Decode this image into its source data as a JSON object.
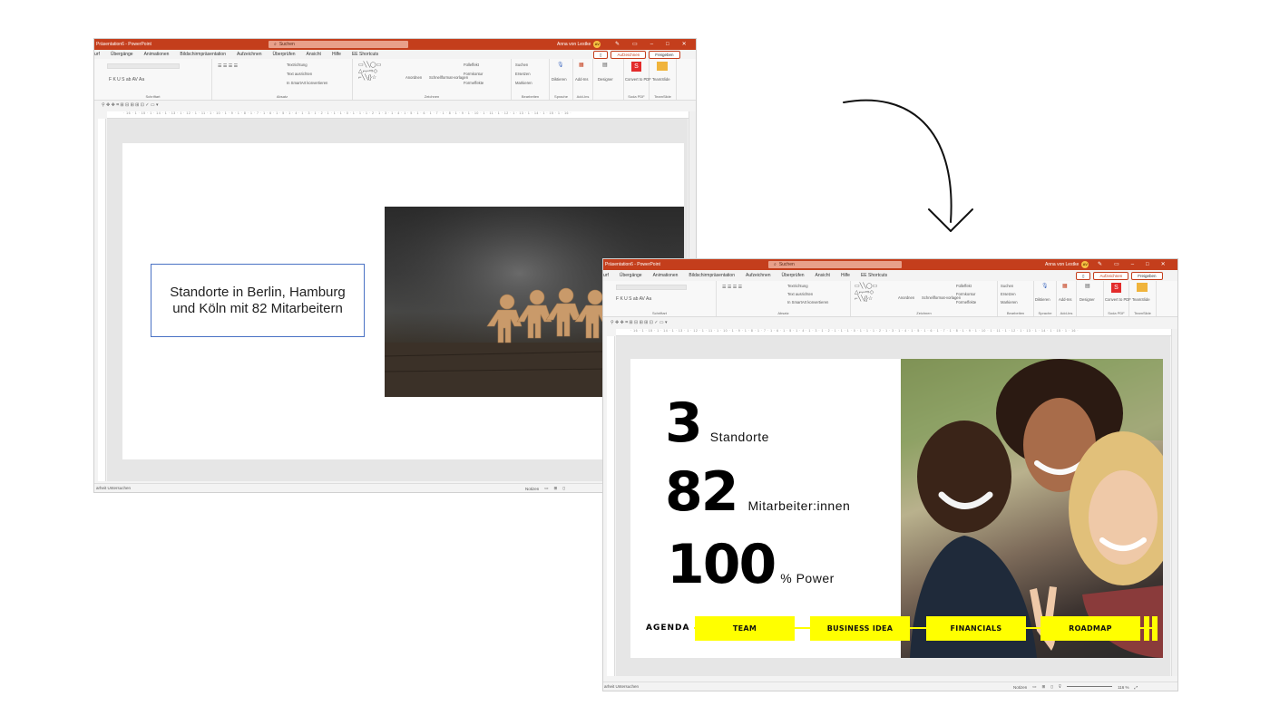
{
  "app": {
    "title_left": "Präsentation6 - PowerPoint",
    "title_right": "Präsentation6 - PowerPoint",
    "search_placeholder": "Suchen",
    "user_name": "Anna von Lestke",
    "user_initials": "AV"
  },
  "ribbon": {
    "tabs_left": [
      "urf",
      "Übergänge",
      "Animationen",
      "Bildschirmpräsentation",
      "Aufzeichnen",
      "Überprüfen",
      "Ansicht",
      "Hilfe",
      "EE Shortcuts"
    ],
    "tabs_right": [
      "urf",
      "Übergänge",
      "Animationen",
      "Bildschirmpräsentation",
      "Aufzeichnen",
      "Überprüfen",
      "Ansicht",
      "Hilfe",
      "EE Shortcuts"
    ],
    "record_label": "Aufzeichnen",
    "share_label": "Freigeben",
    "groups": {
      "schriftart": "Schriftart",
      "absatz": "Absatz",
      "zeichnen": "Zeichnen",
      "bearbeiten": "Bearbeiten",
      "sprache": "Sprache",
      "addins": "Add-Ins",
      "soda": "Soda PDF",
      "teamslide": "TeamSlide"
    },
    "items": {
      "suchen": "Suchen",
      "ersetzen": "Ersetzen",
      "markieren": "Markieren",
      "diktieren": "Diktieren",
      "addins": "Add-Ins",
      "designer": "Designer",
      "convert": "Convert to PDF",
      "teamslide": "TeamSlide",
      "anordnen": "Anordnen",
      "schnellformat": "Schnellformat-vorlagen",
      "fuelleffekt": "Fülleffekt",
      "formkontur": "Formkontur",
      "formeffekte": "Formeffekte",
      "textrichtung": "Textrichtung",
      "text_ausrichten": "Text ausrichten",
      "smartart": "In SmartArt konvertieren"
    }
  },
  "ruler_text": "· 16 · 1 · 15 · 1 · 14 · 1 · 13 · 1 · 12 · 1 · 11 · 1 · 10 · 1 · 9 · 1 · 8 · 1 · 7 · 1 · 6 · 1 · 5 · 1 · 4 · 1 · 3 · 1 · 2 · 1 · 1 · 1 · 0 · 1 · 1 · 1 · 2 · 1 · 3 · 1 · 4 · 1 · 5 · 1 · 6 · 1 · 7 · 1 · 8 · 1 · 9 · 1 · 10 · 1 · 11 · 1 · 12 · 1 · 13 · 1 · 14 · 1 · 15 · 1 · 16 ·",
  "status": {
    "left": "arheit Untersuchen",
    "notes": "Notizen",
    "zoom": "116 %"
  },
  "slide_before": {
    "text": "Standorte in Berlin, Hamburg und Köln mit 82 Mitarbeitern"
  },
  "slide_after": {
    "stats": [
      {
        "number": "3",
        "label": "Standorte"
      },
      {
        "number": "82",
        "label": "Mitarbeiter:innen"
      },
      {
        "number": "100",
        "label": "% Power"
      }
    ],
    "agenda_label": "AGENDA",
    "agenda_items": [
      "TEAM",
      "BUSINESS IDEA",
      "FINANCIALS",
      "ROADMAP"
    ]
  },
  "colors": {
    "title_bar": "#c43e1c",
    "agenda_yellow": "#ffff00",
    "textbox_border": "#4a72c4"
  },
  "icons": [
    "search-icon",
    "arrow-icon",
    "microphone-icon",
    "designer-icon",
    "pdf-icon",
    "teamslide-icon"
  ]
}
